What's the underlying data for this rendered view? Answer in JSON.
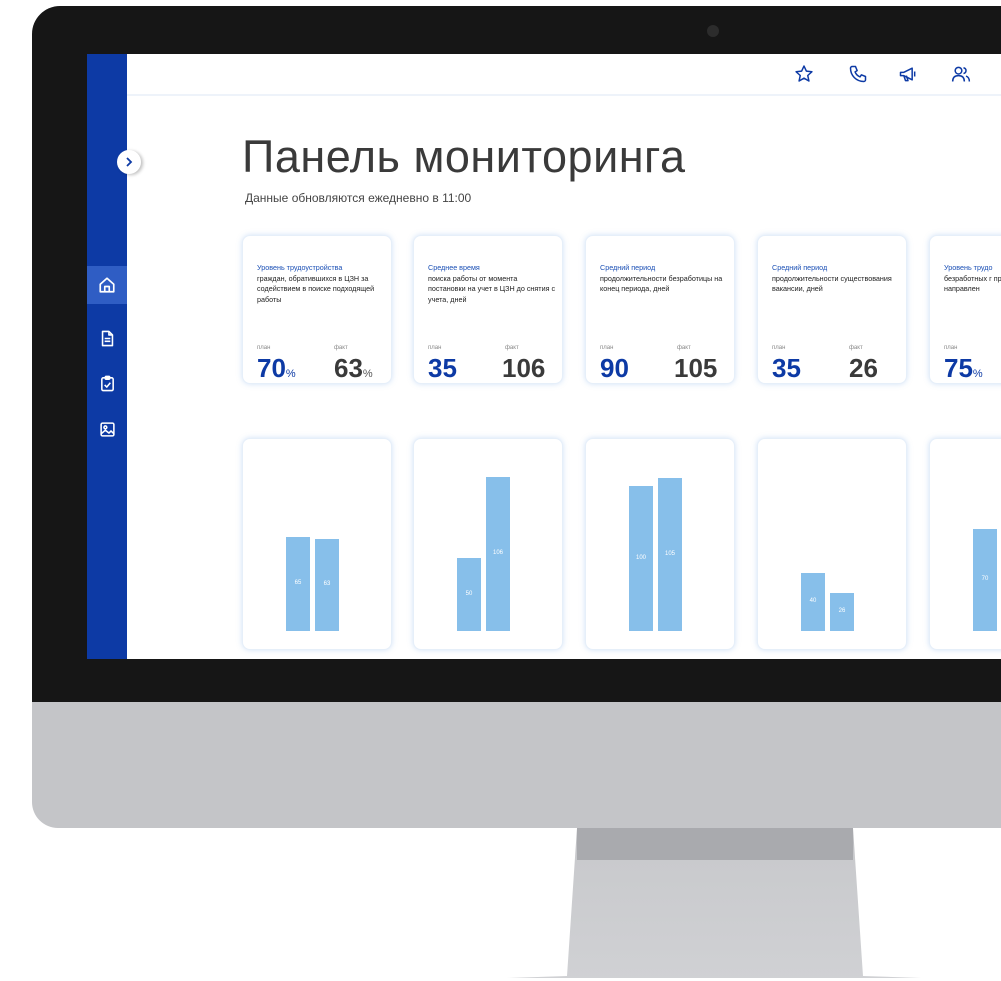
{
  "header": {
    "title": "Панель мониторинга",
    "subtitle": "Данные обновляются ежедневно в 11:00"
  },
  "topbar": {
    "icons": [
      "star-icon",
      "phone-icon",
      "megaphone-icon",
      "users-icon"
    ]
  },
  "sidebar": {
    "items": [
      {
        "icon": "home-icon",
        "active": true
      },
      {
        "icon": "document-icon",
        "active": false
      },
      {
        "icon": "clipboard-check-icon",
        "active": false
      },
      {
        "icon": "image-icon",
        "active": false
      }
    ]
  },
  "colors": {
    "accent": "#0d3aa5",
    "bar": "#87bfea",
    "title": "#3a3a3a"
  },
  "kpis": [
    {
      "lead": "Уровень трудоустройства",
      "rest": "граждан, обратившихся в ЦЗН за содействием в поиске подходящей работы",
      "plan_caption": "план",
      "fact_caption": "факт",
      "plan": "70",
      "fact": "63",
      "unit": "%"
    },
    {
      "lead": "Среднее время",
      "rest": "поиска работы от момента постановки на учет в ЦЗН до снятия с учета, дней",
      "plan_caption": "план",
      "fact_caption": "факт",
      "plan": "35",
      "fact": "106",
      "unit": ""
    },
    {
      "lead": "Средний период",
      "rest": "продолжительности безработицы на конец периода, дней",
      "plan_caption": "план",
      "fact_caption": "факт",
      "plan": "90",
      "fact": "105",
      "unit": ""
    },
    {
      "lead": "Средний период",
      "rest": "продолжительности существования вакансии, дней",
      "plan_caption": "план",
      "fact_caption": "факт",
      "plan": "35",
      "fact": "26",
      "unit": ""
    },
    {
      "lead": "Уровень трудо",
      "rest": "безработных г прошедших о по направлен",
      "plan_caption": "план",
      "fact_caption": "",
      "plan": "75",
      "fact": "",
      "unit": "%"
    }
  ],
  "chart_data": [
    {
      "type": "bar",
      "categories": [
        "план",
        "факт"
      ],
      "values": [
        65,
        63
      ],
      "labels": [
        "65",
        "63"
      ],
      "ylim": [
        0,
        106
      ]
    },
    {
      "type": "bar",
      "categories": [
        "план",
        "факт"
      ],
      "values": [
        50,
        106
      ],
      "labels": [
        "50",
        "106"
      ],
      "ylim": [
        0,
        106
      ]
    },
    {
      "type": "bar",
      "categories": [
        "план",
        "факт"
      ],
      "values": [
        100,
        105
      ],
      "labels": [
        "100",
        "105"
      ],
      "ylim": [
        0,
        106
      ]
    },
    {
      "type": "bar",
      "categories": [
        "план",
        "факт"
      ],
      "values": [
        40,
        26
      ],
      "labels": [
        "40",
        "26"
      ],
      "ylim": [
        0,
        106
      ]
    },
    {
      "type": "bar",
      "categories": [
        "план"
      ],
      "values": [
        70
      ],
      "labels": [
        "70"
      ],
      "ylim": [
        0,
        106
      ]
    }
  ]
}
